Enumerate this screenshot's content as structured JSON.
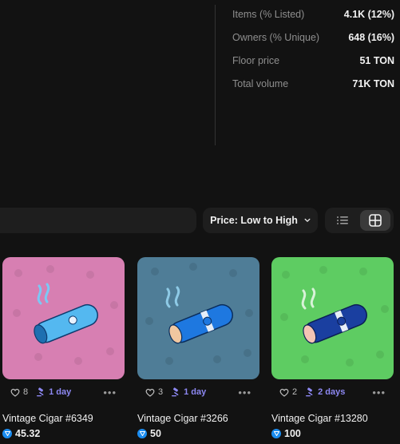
{
  "stats": [
    {
      "label": "Items (% Listed)",
      "value": "4.1K (12%)"
    },
    {
      "label": "Owners (% Unique)",
      "value": "648 (16%)"
    },
    {
      "label": "Floor price",
      "value": "51 TON"
    },
    {
      "label": "Total volume",
      "value": "71K TON"
    }
  ],
  "toolbar": {
    "sort_label": "Price: Low to High",
    "view_list_icon": "list-icon",
    "view_grid_icon": "grid-icon"
  },
  "cards": [
    {
      "name": "Vintage Cigar #6349",
      "likes": "8",
      "auction": "1 day",
      "price": "45.32",
      "bg": "#d77fb2",
      "cigar": "#54b8f0"
    },
    {
      "name": "Vintage Cigar #3266",
      "likes": "3",
      "auction": "1 day",
      "price": "50",
      "bg": "#4f7d97",
      "cigar": "#1e78e0"
    },
    {
      "name": "Vintage Cigar #13280",
      "likes": "2",
      "auction": "2 days",
      "price": "100",
      "bg": "#5ecc62",
      "cigar": "#1a3fa0"
    }
  ],
  "colors": {
    "accent": "#8d88f2",
    "ton": "#1a8cf0"
  }
}
